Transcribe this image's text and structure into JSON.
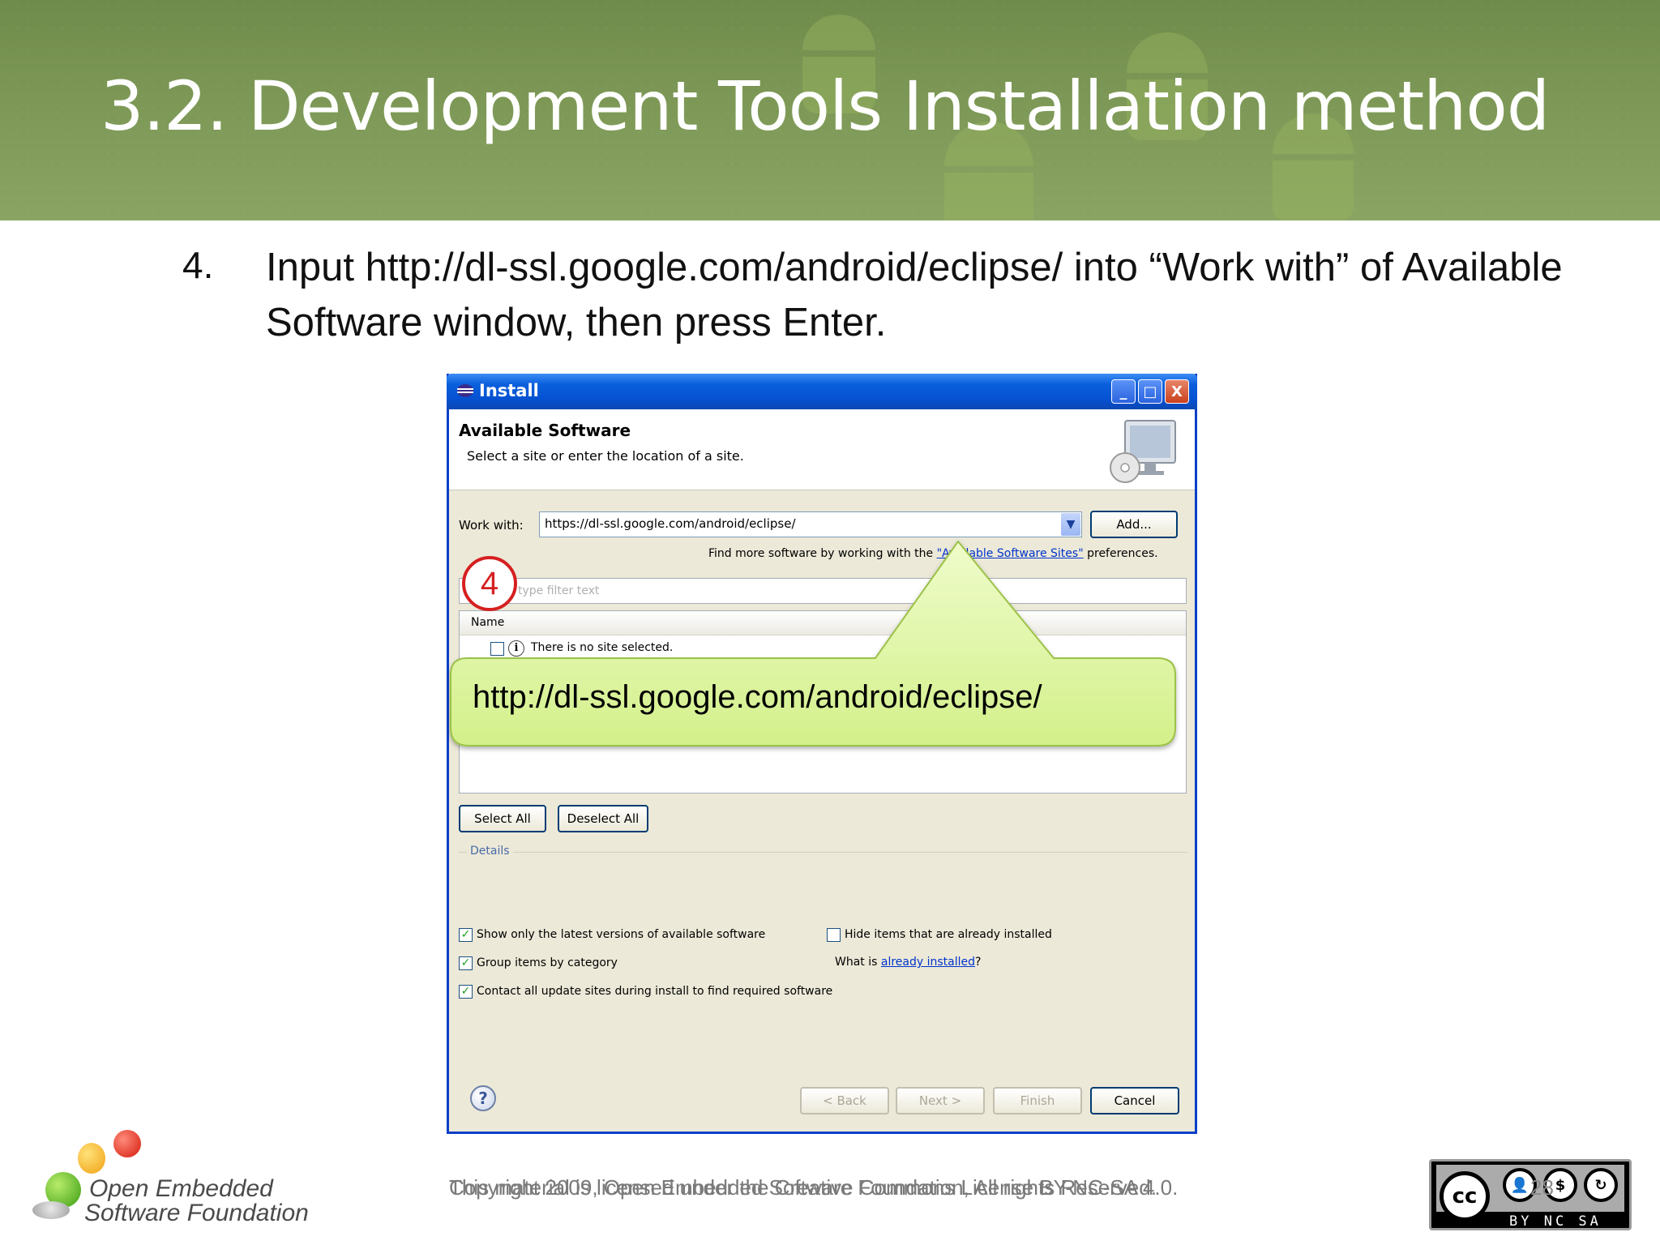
{
  "slide": {
    "title": "3.2. Development Tools Installation method",
    "step_number": "4.",
    "step_text": "Input http://dl-ssl.google.com/android/eclipse/ into “Work with” of Available Software window, then press Enter."
  },
  "window": {
    "title": "Install",
    "minimize_glyph": "_",
    "maximize_glyph": "□",
    "close_glyph": "X",
    "heading": "Available Software",
    "subheading": "Select a site or enter the location of a site.",
    "work_with_label": "Work with:",
    "work_with_value": "https://dl-ssl.google.com/android/eclipse/",
    "add_button": "Add...",
    "find_more_prefix": "Find more software by working with the",
    "find_more_link": "\"Available Software Sites\"",
    "find_more_suffix": "preferences.",
    "filter_placeholder": "type filter text",
    "column_name": "Name",
    "no_site_message": "There is no site selected.",
    "select_all_button": "Select All",
    "deselect_all_button": "Deselect All",
    "details_label": "Details",
    "options": {
      "latest_versions": "Show only the latest versions of available software",
      "hide_installed": "Hide items that are already installed",
      "group_by_category": "Group items by category",
      "what_is_prefix": "What is",
      "what_is_link": "already installed",
      "what_is_suffix": "?",
      "contact_sites": "Contact all update sites during install to find required software"
    },
    "checkbox_states": {
      "latest_versions": true,
      "hide_installed": false,
      "group_by_category": true,
      "contact_sites": true
    },
    "back_button": "< Back",
    "next_button": "Next >",
    "finish_button": "Finish",
    "cancel_button": "Cancel",
    "help_glyph": "?"
  },
  "annotation": {
    "badge": "4",
    "callout_text": "http://dl-ssl.google.com/android/eclipse/"
  },
  "footer": {
    "copyright_a": "Copyright 2009, Open Embedded Software Foundation, All rights Reserved.",
    "copyright_b": "This material is licensed under the Creative Commons License BY-NC-SA 4.0.",
    "page_number": "28",
    "logo_line1": "Open Embedded",
    "logo_line2": "Software Foundation",
    "cc_label": "cc",
    "cc_codes": "BY NC SA"
  },
  "colors": {
    "header_green": "#7d9856",
    "callout_fill": "#ddf59e",
    "badge_red": "#d62020",
    "xp_blue": "#0552d2"
  }
}
